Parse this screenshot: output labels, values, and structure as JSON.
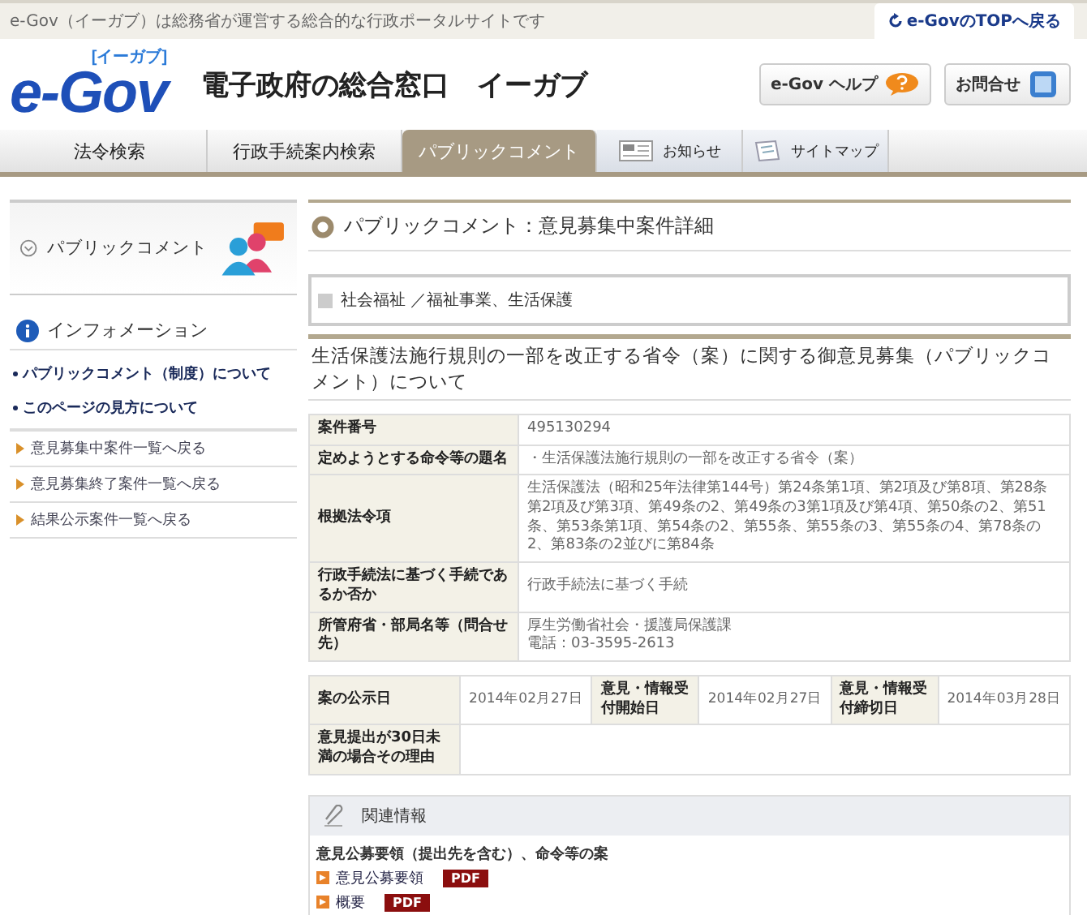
{
  "top_bar": {
    "tagline": "e-Gov（イーガブ）は総務省が運営する総合的な行政ポータルサイトです",
    "top_link": "e-GovのTOPへ戻る"
  },
  "header": {
    "logo": "e-Gov",
    "logo_reading": "[イーガブ]",
    "site_title": "電子政府の総合窓口　イーガブ",
    "buttons": [
      {
        "label": "e-Gov ヘルプ",
        "kind": "help"
      },
      {
        "label": "お問合せ",
        "kind": "contact"
      }
    ]
  },
  "nav": [
    {
      "label": "法令検索",
      "selected": false,
      "kind": "text"
    },
    {
      "label": "行政手続案内検索",
      "selected": false,
      "kind": "text"
    },
    {
      "label": "パブリックコメント",
      "selected": true,
      "kind": "text"
    },
    {
      "label": "お知らせ",
      "selected": false,
      "kind": "icon"
    },
    {
      "label": "サイトマップ",
      "selected": false,
      "kind": "icon"
    }
  ],
  "sidebar": {
    "section_title": "パブリックコメント",
    "info_title": "インフォメーション",
    "info_links": [
      "パブリックコメント（制度）について",
      "このページの見方について"
    ],
    "back_links": [
      "意見募集中案件一覧へ戻る",
      "意見募集終了案件一覧へ戻る",
      "結果公示案件一覧へ戻る"
    ]
  },
  "main": {
    "page_title": "パブリックコメント：意見募集中案件詳細",
    "category": "社会福祉 ／福祉事業、生活保護",
    "case_title": "生活保護法施行規則の一部を改正する省令（案）に関する御意見募集（パブリックコメント）について",
    "details": [
      {
        "label": "案件番号",
        "lines": [
          "495130294"
        ]
      },
      {
        "label": "定めようとする命令等の題名",
        "lines": [
          "・生活保護法施行規則の一部を改正する省令（案）"
        ]
      },
      {
        "label": "根拠法令項",
        "lines": [
          "生活保護法（昭和25年法律第144号）第24条第1項、第2項及び第8項、第28条第2項及び第3項、第49条の2、第49条の3第1項及び第4項、第50条の2、第51条、第53条第1項、第54条の2、第55条、第55条の3、第55条の4、第78条の2、第83条の2並びに第84条"
        ]
      },
      {
        "label": "行政手続法に基づく手続であるか否か",
        "lines": [
          "行政手続法に基づく手続"
        ]
      },
      {
        "label": "所管府省・部局名等（問合せ先）",
        "lines": [
          "厚生労働省社会・援護局保護課",
          "電話：03-3595-2613"
        ]
      }
    ],
    "dates": [
      {
        "label": "案の公示日",
        "value": "2014年02月27日"
      },
      {
        "label": "意見・情報受付開始日",
        "value": "2014年02月27日"
      },
      {
        "label": "意見・情報受付締切日",
        "value": "2014年03月28日"
      }
    ],
    "reason_label": "意見提出が30日未満の場合その理由",
    "related": {
      "title": "関連情報",
      "subtitle": "意見公募要領（提出先を含む）、命令等の案",
      "files": [
        {
          "name": "意見公募要領",
          "badge": "PDF"
        },
        {
          "name": "概要",
          "badge": "PDF"
        }
      ]
    }
  }
}
